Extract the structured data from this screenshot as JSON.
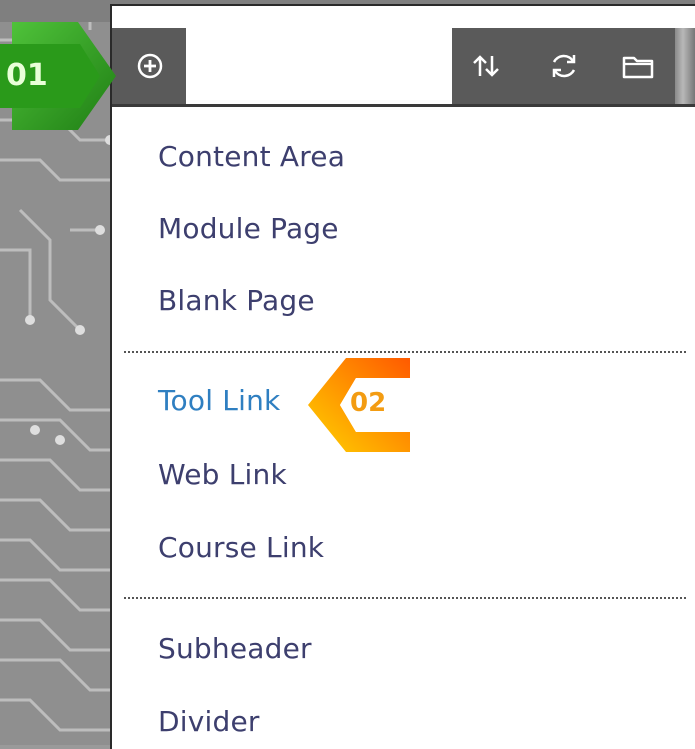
{
  "toolbar": {
    "add_icon": "plus-circle-icon",
    "input_value": "",
    "sort_icon": "sort-arrows-icon",
    "refresh_icon": "refresh-icon",
    "folder_icon": "folder-icon"
  },
  "menu": {
    "items": [
      {
        "label": "Content Area"
      },
      {
        "label": "Module Page"
      },
      {
        "label": "Blank Page"
      },
      {
        "label": "Tool Link"
      },
      {
        "label": "Web Link"
      },
      {
        "label": "Course Link"
      },
      {
        "label": "Subheader"
      },
      {
        "label": "Divider"
      }
    ]
  },
  "callouts": {
    "step1": "01",
    "step2": "02"
  },
  "colors": {
    "menu_text": "#3d3f6e",
    "active_text": "#2f7fc1",
    "toolbar_bg": "#5a5a5a",
    "callout_green": "#2e9e1f",
    "callout_orange": "#f39c12"
  }
}
